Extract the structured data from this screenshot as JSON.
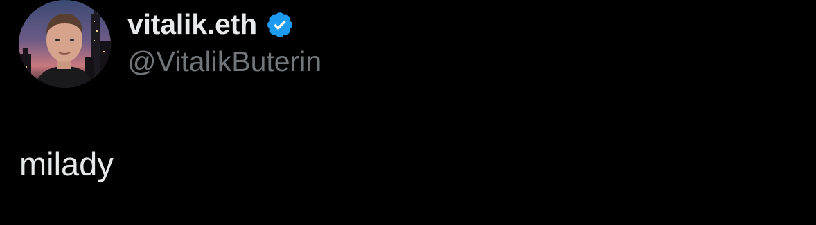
{
  "tweet": {
    "author": {
      "display_name": "vitalik.eth",
      "handle": "@VitalikButerin",
      "verified": true,
      "verified_badge_color": "#1d9bf0",
      "avatar_icon": "profile-photo"
    },
    "text": "milady"
  },
  "colors": {
    "background": "#000000",
    "primary_text": "#e7e9ea",
    "secondary_text": "#71767b",
    "accent": "#1d9bf0"
  }
}
